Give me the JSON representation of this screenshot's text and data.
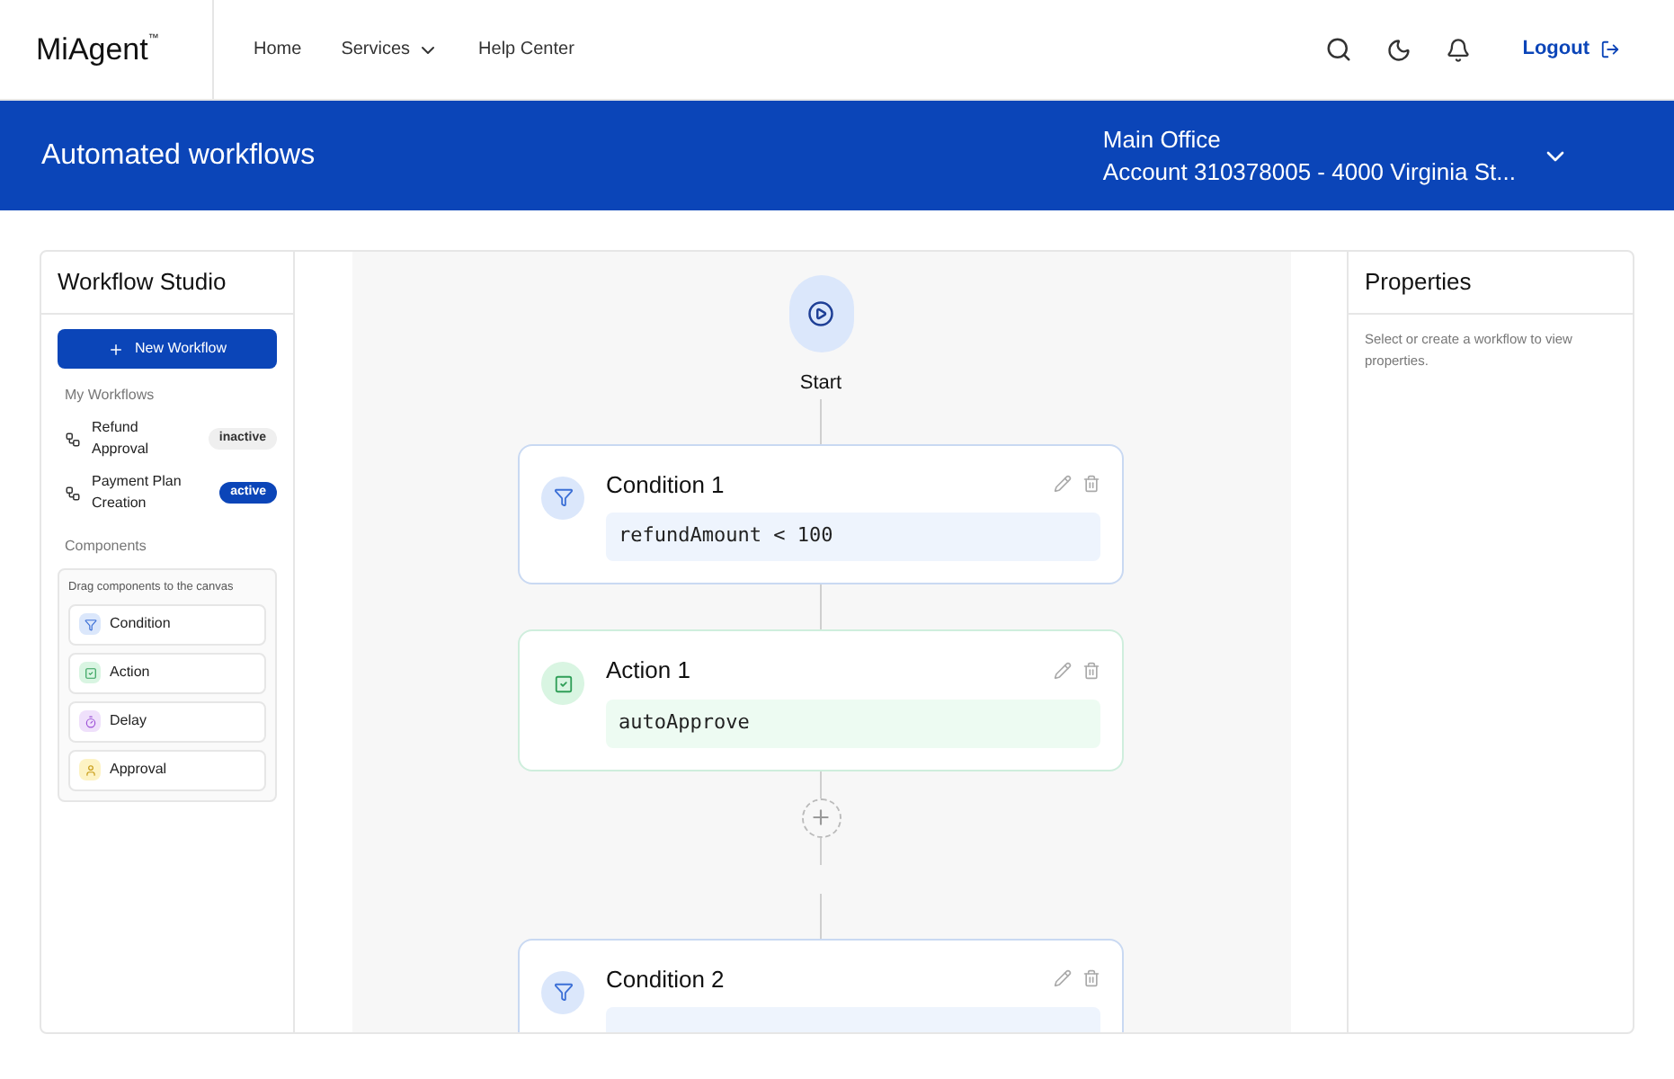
{
  "header": {
    "logo": "MiAgent",
    "logo_mark": "™",
    "nav": [
      {
        "label": "Home",
        "dropdown": false
      },
      {
        "label": "Services",
        "dropdown": true
      },
      {
        "label": "Help Center",
        "dropdown": false
      }
    ],
    "logout": "Logout"
  },
  "banner": {
    "title": "Automated workflows",
    "office": "Main Office",
    "account": "Account 310378005 - 4000 Virginia St..."
  },
  "sidebar": {
    "title": "Workflow Studio",
    "new_button": "New Workflow",
    "workflows_heading": "My Workflows",
    "workflows": [
      {
        "name": "Refund Approval",
        "status": "inactive",
        "active": false
      },
      {
        "name": "Payment Plan Creation",
        "status": "active",
        "active": true
      }
    ],
    "components_heading": "Components",
    "components_hint": "Drag components to the canvas",
    "components": [
      {
        "kind": "condition",
        "label": "Condition"
      },
      {
        "kind": "action",
        "label": "Action"
      },
      {
        "kind": "delay",
        "label": "Delay"
      },
      {
        "kind": "approval",
        "label": "Approval"
      }
    ]
  },
  "canvas": {
    "start_label": "Start",
    "nodes": [
      {
        "kind": "condition",
        "title": "Condition 1",
        "code": "refundAmount < 100"
      },
      {
        "kind": "action",
        "title": "Action 1",
        "code": "autoApprove"
      },
      {
        "kind": "add"
      },
      {
        "kind": "condition",
        "title": "Condition 2"
      }
    ]
  },
  "properties": {
    "title": "Properties",
    "hint": "Select or create a workflow to view properties."
  }
}
